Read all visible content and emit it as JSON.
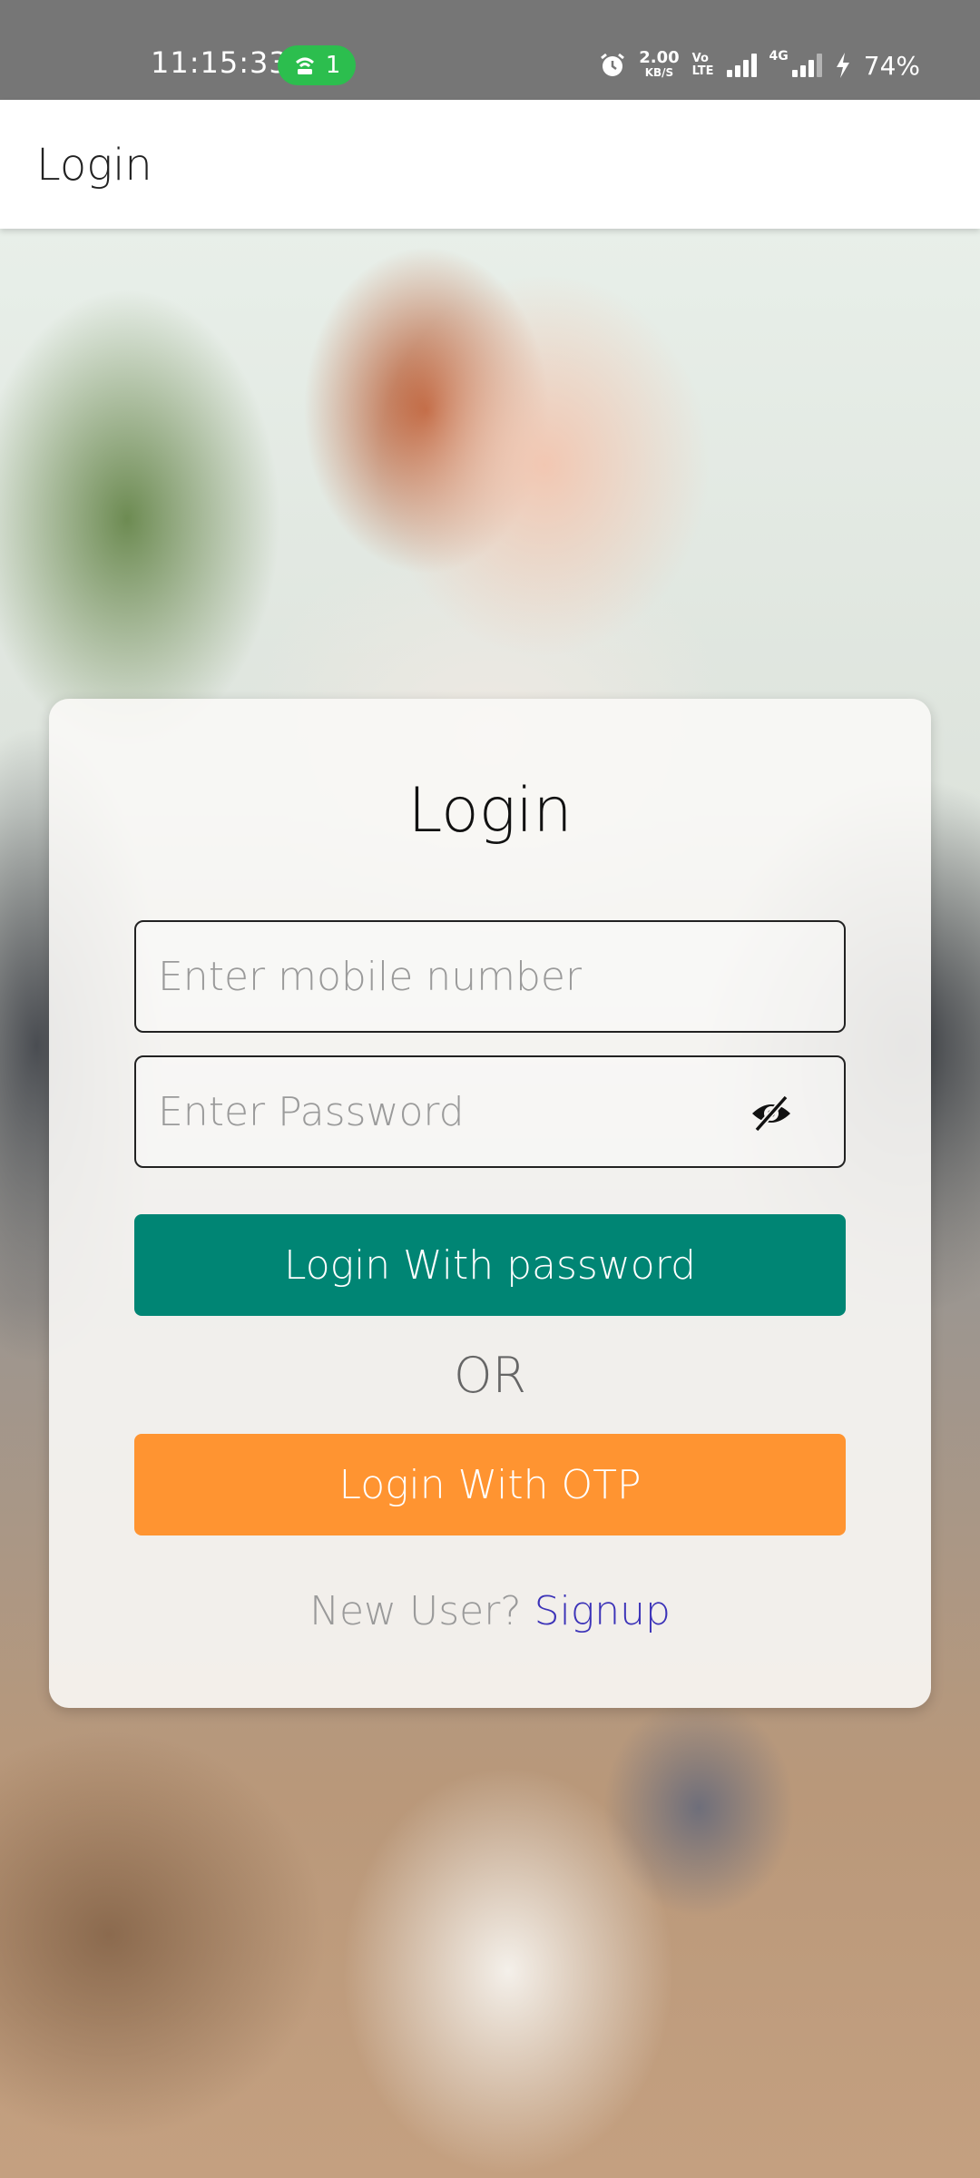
{
  "status_bar": {
    "time": "11:15:33",
    "hotspot_count": "1",
    "net_speed_value": "2.00",
    "net_speed_unit": "KB/S",
    "volte_top": "Vo",
    "volte_bottom": "LTE",
    "network_tag": "4G",
    "battery": "74%",
    "hotspot_color": "#2cbe4e"
  },
  "app_bar": {
    "title": "Login"
  },
  "login_card": {
    "title": "Login",
    "mobile_placeholder": "Enter mobile number",
    "mobile_value": "",
    "password_placeholder": "Enter Password",
    "password_value": "",
    "password_toggle_icon": "eye-off-icon",
    "login_password_label": "Login With password",
    "or_label": "OR",
    "login_otp_label": "Login With OTP",
    "new_user_prompt": "New User?",
    "signup_label": "Signup"
  },
  "colors": {
    "primary_button": "#008574",
    "otp_button": "#ff9431",
    "signup_link": "#3c33b8"
  }
}
